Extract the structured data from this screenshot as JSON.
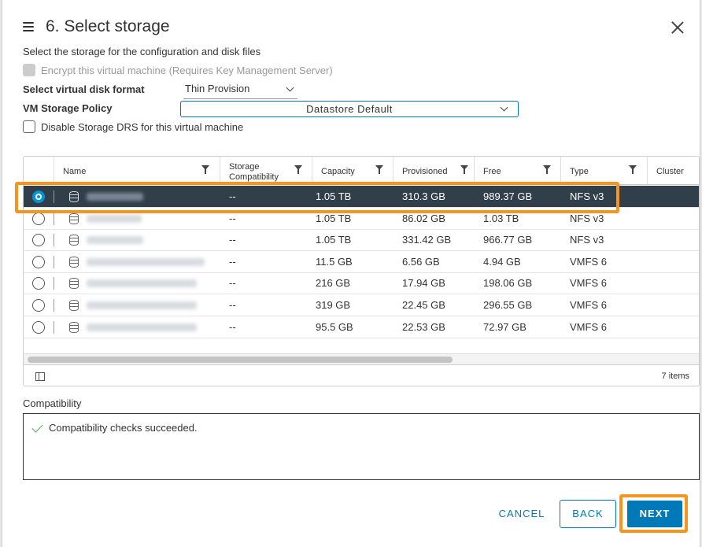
{
  "dialog": {
    "title": "6. Select storage",
    "subtitle": "Select the storage for the configuration and disk files"
  },
  "encrypt": {
    "label": "Encrypt this virtual machine (Requires Key Management Server)",
    "checked": false,
    "disabled": true
  },
  "disk_format": {
    "label": "Select virtual disk format",
    "value": "Thin Provision"
  },
  "storage_policy": {
    "label": "VM Storage Policy",
    "value": "Datastore Default"
  },
  "disable_drs": {
    "label": "Disable Storage DRS for this virtual machine",
    "checked": false
  },
  "table": {
    "columns": [
      "Name",
      "Storage Compatibility",
      "Capacity",
      "Provisioned",
      "Free",
      "Type",
      "Cluster"
    ],
    "storage_compat_line1": "Storage",
    "storage_compat_line2": "Compatibility",
    "rows": [
      {
        "compat": "--",
        "capacity": "1.05 TB",
        "provisioned": "310.3 GB",
        "free": "989.37 GB",
        "type": "NFS v3",
        "selected": true
      },
      {
        "compat": "--",
        "capacity": "1.05 TB",
        "provisioned": "86.02 GB",
        "free": "1.03 TB",
        "type": "NFS v3",
        "selected": false
      },
      {
        "compat": "--",
        "capacity": "1.05 TB",
        "provisioned": "331.42 GB",
        "free": "966.77 GB",
        "type": "NFS v3",
        "selected": false
      },
      {
        "compat": "--",
        "capacity": "11.5 GB",
        "provisioned": "6.56 GB",
        "free": "4.94 GB",
        "type": "VMFS 6",
        "selected": false
      },
      {
        "compat": "--",
        "capacity": "216 GB",
        "provisioned": "17.94 GB",
        "free": "198.06 GB",
        "type": "VMFS 6",
        "selected": false
      },
      {
        "compat": "--",
        "capacity": "319 GB",
        "provisioned": "22.45 GB",
        "free": "296.55 GB",
        "type": "VMFS 6",
        "selected": false
      },
      {
        "compat": "--",
        "capacity": "95.5 GB",
        "provisioned": "22.53 GB",
        "free": "72.97 GB",
        "type": "VMFS 6",
        "selected": false
      }
    ],
    "item_count": "7 items"
  },
  "compatibility": {
    "label": "Compatibility",
    "message": "Compatibility checks succeeded."
  },
  "buttons": {
    "cancel": "CANCEL",
    "back": "BACK",
    "next": "NEXT"
  },
  "colors": {
    "accent": "#0079b8",
    "highlight": "#f7941e",
    "selected_row": "#313f4b",
    "success": "#4caf50"
  },
  "icons": [
    "menu-icon",
    "close-icon",
    "filter-icon",
    "database-icon",
    "column-toggle-icon",
    "check-icon"
  ]
}
